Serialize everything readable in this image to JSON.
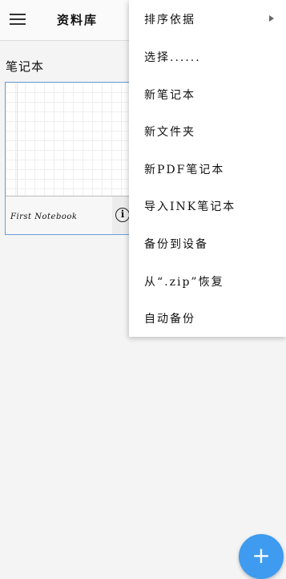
{
  "appbar": {
    "title": "资料库",
    "menu_icon": "hamburger-menu-icon"
  },
  "library": {
    "section_title": "笔记本",
    "notebooks": [
      {
        "name": "First Notebook",
        "info_icon": "info-icon"
      }
    ]
  },
  "overflow_menu": {
    "items": [
      {
        "label": "排序依据",
        "has_submenu": true
      },
      {
        "label": "选择......"
      },
      {
        "label": "新笔记本"
      },
      {
        "label": "新文件夹"
      },
      {
        "label": "新PDF笔记本"
      },
      {
        "label": "导入INK笔记本"
      },
      {
        "label": "备份到设备"
      },
      {
        "label": "从“.zip”恢复"
      },
      {
        "label": "自动备份"
      }
    ]
  },
  "fab": {
    "icon": "plus-icon",
    "symbol": "+",
    "color": "#3e9bef"
  }
}
